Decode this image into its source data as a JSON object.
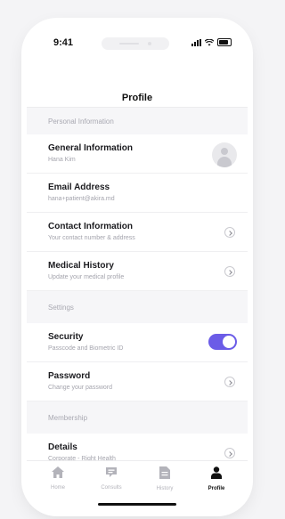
{
  "status_bar": {
    "time": "9:41"
  },
  "header": {
    "title": "Profile"
  },
  "sections": {
    "personal": {
      "heading": "Personal Information",
      "general": {
        "title": "General Information",
        "subtitle": "Hana Kim"
      },
      "email": {
        "title": "Email Address",
        "subtitle": "hana+patient@akira.md"
      },
      "contact": {
        "title": "Contact Information",
        "subtitle": "Your contact number & address"
      },
      "medical": {
        "title": "Medical History",
        "subtitle": "Update your medical profile"
      }
    },
    "settings": {
      "heading": "Settings",
      "security": {
        "title": "Security",
        "subtitle": "Passcode and Biometric ID",
        "toggle_on": true
      },
      "password": {
        "title": "Password",
        "subtitle": "Change your password"
      }
    },
    "membership": {
      "heading": "Membership",
      "details": {
        "title": "Details",
        "subtitle": "Corporate - Right Health"
      }
    }
  },
  "tabs": [
    {
      "label": "Home",
      "icon": "home-icon"
    },
    {
      "label": "Consults",
      "icon": "chat-icon"
    },
    {
      "label": "History",
      "icon": "document-icon"
    },
    {
      "label": "Profile",
      "icon": "person-icon"
    }
  ],
  "colors": {
    "accent": "#6b5ce7"
  }
}
